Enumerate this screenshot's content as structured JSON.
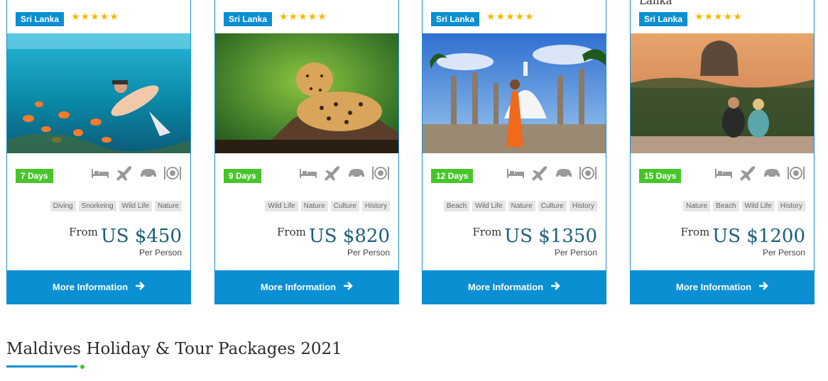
{
  "cards": [
    {
      "above_title": "",
      "badge": "Sri Lanka",
      "stars": "★★★★★",
      "days": "7 Days",
      "tags": [
        "Diving",
        "Snorkeing",
        "Wild Life",
        "Nature"
      ],
      "from_label": "From",
      "price": "US $450",
      "per_person": "Per Person",
      "button": "More Information",
      "image_subject": "snorkeling-underwater"
    },
    {
      "above_title": "",
      "badge": "Sri Lanka",
      "stars": "★★★★★",
      "days": "9 Days",
      "tags": [
        "Wild Life",
        "Nature",
        "Culture",
        "History"
      ],
      "from_label": "From",
      "price": "US $820",
      "per_person": "Per Person",
      "button": "More Information",
      "image_subject": "leopard-on-log"
    },
    {
      "above_title": "",
      "badge": "Sri Lanka",
      "stars": "★★★★★",
      "days": "12 Days",
      "tags": [
        "Beach",
        "Wild Life",
        "Nature",
        "Culture",
        "History"
      ],
      "from_label": "From",
      "price": "US $1350",
      "per_person": "Per Person",
      "button": "More Information",
      "image_subject": "monk-at-stupa"
    },
    {
      "above_title": "Lanka",
      "badge": "Sri Lanka",
      "stars": "★★★★★",
      "days": "15 Days",
      "tags": [
        "Nature",
        "Beach",
        "Wild Life",
        "History"
      ],
      "from_label": "From",
      "price": "US $1200",
      "per_person": "Per Person",
      "button": "More Information",
      "image_subject": "couple-viewing-sigiriya"
    }
  ],
  "amenity_icons": [
    "bed-icon",
    "plane-icon",
    "car-icon",
    "dining-icon"
  ],
  "section": {
    "title": "Maldives Holiday & Tour Packages 2021"
  },
  "colors": {
    "accent_blue": "#0a8fd3",
    "days_green": "#48c52b",
    "star_gold": "#f5b800",
    "price_teal": "#1a5e7a"
  }
}
